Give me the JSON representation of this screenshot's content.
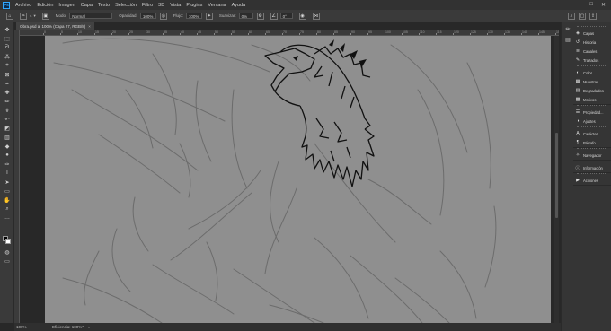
{
  "menubar": {
    "logo": "Ps",
    "items": [
      "Archivo",
      "Edición",
      "Imagen",
      "Capa",
      "Texto",
      "Selección",
      "Filtro",
      "3D",
      "Vista",
      "Plugins",
      "Ventana",
      "Ayuda"
    ],
    "window_controls": [
      "—",
      "□",
      "✕"
    ]
  },
  "options": {
    "size_value": "4",
    "mode_label": "Modo:",
    "mode_value": "Normal",
    "opacity_label": "Opacidad:",
    "opacity_value": "100%",
    "flow_label": "Flujo:",
    "flow_value": "100%",
    "smoothing_label": "Suavizar:",
    "smoothing_value": "0%",
    "angle_value": "0°"
  },
  "document": {
    "tab_title": "Obra.psd al 100% (Capa 27, RGB/8)",
    "tab_close": "×"
  },
  "ruler": {
    "top_labels": [
      "0",
      "5",
      "10",
      "15",
      "20",
      "25",
      "30",
      "35",
      "40",
      "45",
      "50",
      "55",
      "60",
      "65",
      "70",
      "75",
      "80",
      "85",
      "90",
      "95",
      "100",
      "105",
      "110",
      "115",
      "120",
      "125",
      "130",
      "135",
      "140",
      "145",
      "150"
    ]
  },
  "status": {
    "zoom": "100%",
    "efficiency": "Eficiencia: 100%*",
    "arrow": ">"
  },
  "panels": {
    "group1": [
      {
        "icon": "layers-icon",
        "glyph": "◈",
        "label": "Capas"
      },
      {
        "icon": "history-icon",
        "glyph": "↺",
        "label": "Historia"
      },
      {
        "icon": "channels-icon",
        "glyph": "≋",
        "label": "Canales"
      },
      {
        "icon": "paths-icon",
        "glyph": "✎",
        "label": "Trazados"
      }
    ],
    "group2": [
      {
        "icon": "color-icon",
        "glyph": "◐",
        "label": "Color"
      },
      {
        "icon": "swatches-icon",
        "glyph": "▦",
        "label": "Muestras"
      },
      {
        "icon": "gradients-icon",
        "glyph": "▤",
        "label": "Degradados"
      },
      {
        "icon": "patterns-icon",
        "glyph": "▩",
        "label": "Motivos"
      }
    ],
    "group3": [
      {
        "icon": "properties-icon",
        "glyph": "☰",
        "label": "Propiedad..."
      },
      {
        "icon": "adjustments-icon",
        "glyph": "◑",
        "label": "Ajustes"
      }
    ],
    "group4": [
      {
        "icon": "character-icon",
        "glyph": "A",
        "label": "Carácter"
      },
      {
        "icon": "paragraph-icon",
        "glyph": "¶",
        "label": "Párrafo"
      }
    ],
    "group5": [
      {
        "icon": "navigator-icon",
        "glyph": "✧",
        "label": "Navegador"
      }
    ],
    "group6": [
      {
        "icon": "info-icon",
        "glyph": "ⓘ",
        "label": "Información"
      }
    ],
    "group7": [
      {
        "icon": "actions-icon",
        "glyph": "▶",
        "label": "Acciones"
      }
    ]
  },
  "tools": [
    {
      "name": "move-tool-icon",
      "glyph": "✥"
    },
    {
      "name": "marquee-tool-icon",
      "glyph": "⬚"
    },
    {
      "name": "lasso-tool-icon",
      "glyph": "ᘐ"
    },
    {
      "name": "quick-select-tool-icon",
      "glyph": "⁂"
    },
    {
      "name": "crop-tool-icon",
      "glyph": "⌗"
    },
    {
      "name": "frame-tool-icon",
      "glyph": "⊠"
    },
    {
      "name": "eyedropper-tool-icon",
      "glyph": "✒"
    },
    {
      "name": "healing-brush-tool-icon",
      "glyph": "✚"
    },
    {
      "name": "brush-tool-icon",
      "glyph": "✏"
    },
    {
      "name": "clone-stamp-tool-icon",
      "glyph": "⚱"
    },
    {
      "name": "history-brush-tool-icon",
      "glyph": "↶"
    },
    {
      "name": "eraser-tool-icon",
      "glyph": "◩"
    },
    {
      "name": "gradient-tool-icon",
      "glyph": "▥"
    },
    {
      "name": "blur-tool-icon",
      "glyph": "◆"
    },
    {
      "name": "dodge-tool-icon",
      "glyph": "●"
    },
    {
      "name": "pen-tool-icon",
      "glyph": "✑"
    },
    {
      "name": "type-tool-icon",
      "glyph": "T"
    },
    {
      "name": "path-select-tool-icon",
      "glyph": "➤"
    },
    {
      "name": "rectangle-tool-icon",
      "glyph": "▭"
    },
    {
      "name": "hand-tool-icon",
      "glyph": "✋"
    },
    {
      "name": "zoom-tool-icon",
      "glyph": "⌕"
    },
    {
      "name": "more-tools-icon",
      "glyph": "…"
    }
  ],
  "colors": {
    "foreground": "#000000",
    "background": "#ffffff",
    "canvas": "#8f8f8f",
    "ui_dark": "#282828"
  }
}
